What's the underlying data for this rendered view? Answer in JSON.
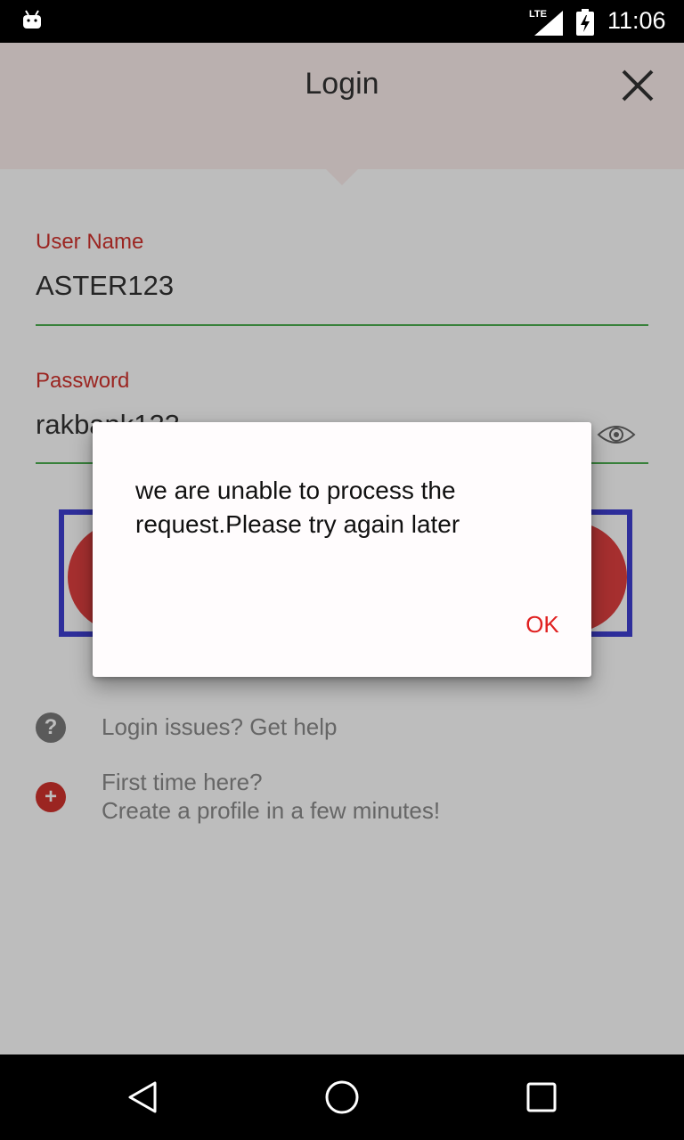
{
  "status_bar": {
    "network": "LTE",
    "time": "11:06"
  },
  "header": {
    "title": "Login",
    "close_icon": "close-icon"
  },
  "form": {
    "username_label": "User Name",
    "username_value": "ASTER123",
    "password_label": "Password",
    "password_value": "rakbank123",
    "show_password_icon": "eye-icon"
  },
  "links": {
    "help_text": "Login issues? Get help",
    "signup_line1": "First time here?",
    "signup_line2": "Create a profile in a few minutes!"
  },
  "dialog": {
    "message": "we are unable to process the request.Please try again later",
    "ok_label": "OK"
  },
  "colors": {
    "accent": "#d2322d",
    "field_underline": "#4caf50",
    "header_bg": "#fbeeec",
    "dialog_button": "#e02020"
  },
  "nav_bar": {
    "icons": [
      "back-icon",
      "home-icon",
      "recents-icon"
    ]
  }
}
